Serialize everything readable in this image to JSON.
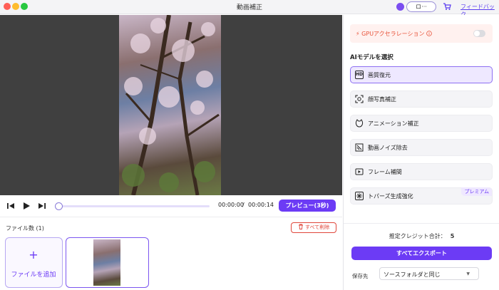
{
  "window": {
    "title": "動画補正",
    "login_label": "ロ···",
    "feedback_label": "フィードバック"
  },
  "player": {
    "current_time": "00:00:00",
    "separator": "/",
    "total_time": "00:00:14",
    "progress": 0,
    "preview_label": "プレビュー(3秒)"
  },
  "files": {
    "count_label": "ファイル数 (1)",
    "delete_all_label": "すべて削除",
    "add_plus": "+",
    "add_label": "ファイルを追加"
  },
  "settings": {
    "gpu_label": "GPUアクセラレーション",
    "gpu_enabled": false,
    "ai_heading": "AIモデルを選択",
    "models": [
      {
        "label": "画質復元",
        "icon": "hd-icon",
        "selected": true
      },
      {
        "label": "顔写真補正",
        "icon": "face-scan-icon",
        "selected": false
      },
      {
        "label": "アニメーション補正",
        "icon": "animation-icon",
        "selected": false
      },
      {
        "label": "動画ノイズ除去",
        "icon": "denoise-icon",
        "selected": false
      },
      {
        "label": "フレーム補間",
        "icon": "frame-interp-icon",
        "selected": false
      },
      {
        "label": "トパーズ生成強化",
        "icon": "topaz-icon",
        "selected": false,
        "badge": "プレミアム"
      }
    ],
    "credits_label": "推定クレジット合計：",
    "credits_value": "5",
    "export_label": "すべてエクスポート",
    "save_to_label": "保存先",
    "save_to_value": "ソースフォルダと同じ"
  },
  "colors": {
    "accent": "#6c3bf5",
    "danger": "#e0463a",
    "gpu_text": "#e8543b"
  }
}
